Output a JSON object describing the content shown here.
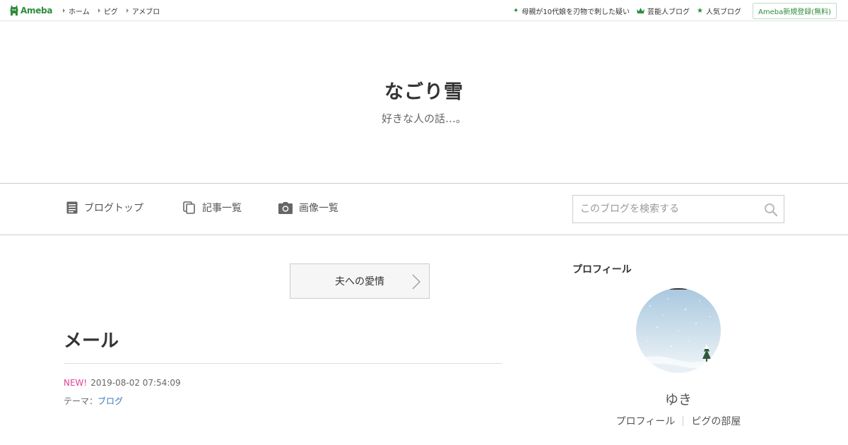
{
  "topbar": {
    "logo_text": "Ameba",
    "nav": [
      "ホーム",
      "ピグ",
      "アメブロ"
    ],
    "links": [
      {
        "icon": "sparkle-icon",
        "label": "母親が10代娘を刃物で刺した疑い"
      },
      {
        "icon": "crown-icon",
        "label": "芸能人ブログ"
      },
      {
        "icon": "star-icon",
        "label": "人気ブログ"
      }
    ],
    "register_label": "Ameba新規登録(無料)",
    "brand_color": "#2d8c3c"
  },
  "header": {
    "title": "なごり雪",
    "description": "好きな人の話…。"
  },
  "nav": {
    "items": [
      {
        "icon": "document-icon",
        "label": "ブログトップ"
      },
      {
        "icon": "copy-icon",
        "label": "記事一覧"
      },
      {
        "icon": "camera-icon",
        "label": "画像一覧"
      }
    ],
    "search_placeholder": "このブログを検索する"
  },
  "main": {
    "theme_button": "夫への愛情",
    "entry": {
      "title": "メール",
      "new_badge": "NEW!",
      "date": "2019-08-02 07:54:09",
      "theme_prefix": "テーマ：",
      "theme_link": "ブログ"
    }
  },
  "sidebar": {
    "heading": "プロフィール",
    "name": "ゆき",
    "links": [
      "プロフィール",
      "ピグの部屋"
    ]
  }
}
